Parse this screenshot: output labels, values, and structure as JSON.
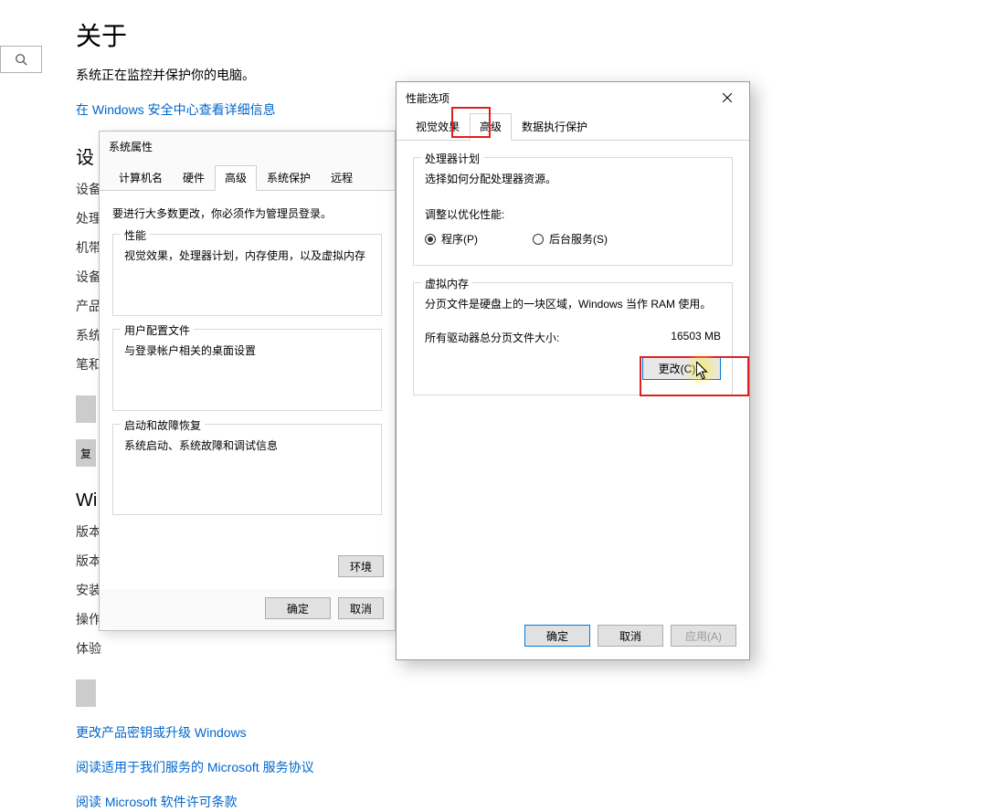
{
  "settings": {
    "title": "关于",
    "subtitle": "系统正在监控并保护你的电脑。",
    "security_link": "在 Windows 安全中心查看详细信息",
    "device_specs_heading": "设",
    "rows": {
      "device": "设备",
      "cpu": "处理",
      "ram": "机带",
      "deviceid": "设备",
      "productid": "产品",
      "systype": "系统",
      "pen": "笔和"
    },
    "copy_btn_prefix": "复",
    "win_heading": "Wi",
    "win_rows": {
      "edition": "版本",
      "ver": "版本",
      "installed": "安装",
      "build": "操作",
      "exp": "体验"
    },
    "links": {
      "pkey": "更改产品密钥或升级 Windows",
      "terms": "阅读适用于我们服务的 Microsoft 服务协议",
      "license": "阅读 Microsoft 软件许可条款"
    }
  },
  "sysprops": {
    "title": "系统属性",
    "tabs": {
      "computer": "计算机名",
      "hardware": "硬件",
      "advanced": "高级",
      "protection": "系统保护",
      "remote": "远程"
    },
    "admin_note": "要进行大多数更改，你必须作为管理员登录。",
    "perf": {
      "title": "性能",
      "desc": "视觉效果，处理器计划，内存使用，以及虚拟内存"
    },
    "profile": {
      "title": "用户配置文件",
      "desc": "与登录帐户相关的桌面设置"
    },
    "startup": {
      "title": "启动和故障恢复",
      "desc": "系统启动、系统故障和调试信息"
    },
    "env_btn": "环境",
    "ok": "确定",
    "cancel": "取消"
  },
  "perfopts": {
    "title": "性能选项",
    "tabs": {
      "visual": "视觉效果",
      "advanced": "高级",
      "dep": "数据执行保护"
    },
    "sched": {
      "title": "处理器计划",
      "desc": "选择如何分配处理器资源。",
      "adjust": "调整以优化性能:",
      "program": "程序(P)",
      "bgservice": "后台服务(S)"
    },
    "vm": {
      "title": "虚拟内存",
      "desc": "分页文件是硬盘上的一块区域，Windows 当作 RAM 使用。",
      "total_label": "所有驱动器总分页文件大小:",
      "total_value": "16503 MB",
      "change": "更改(C)..."
    },
    "ok": "确定",
    "cancel": "取消",
    "apply": "应用(A)"
  }
}
